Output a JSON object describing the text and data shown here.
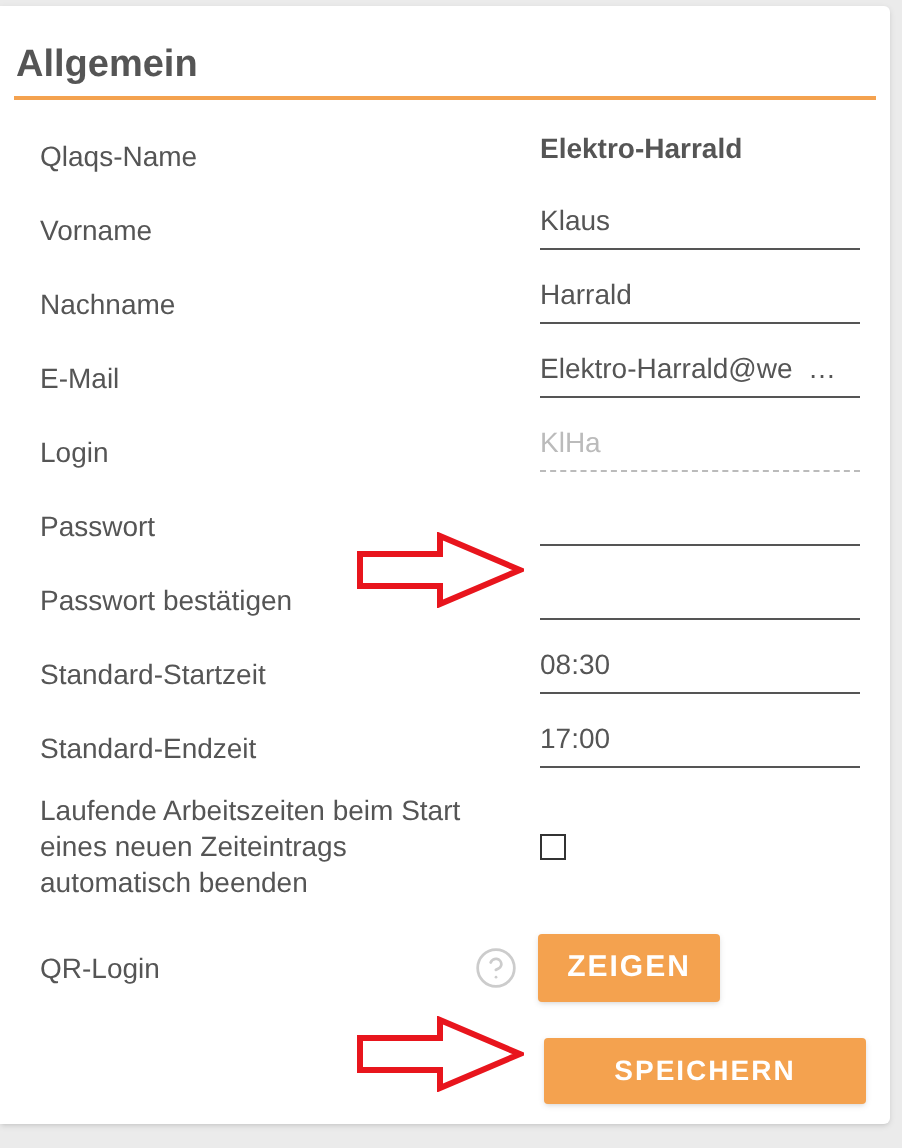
{
  "section": {
    "title": "Allgemein"
  },
  "fields": [
    {
      "label": "Qlaqs-Name",
      "kind": "static",
      "value": "Elektro-Harrald"
    },
    {
      "label": "Vorname",
      "kind": "text",
      "value": "Klaus"
    },
    {
      "label": "Nachname",
      "kind": "text",
      "value": "Harrald"
    },
    {
      "label": "E-Mail",
      "kind": "text",
      "value": "Elektro-Harrald@we  …"
    },
    {
      "label": "Login",
      "kind": "readonly",
      "value": "KlHa"
    },
    {
      "label": "Passwort",
      "kind": "password"
    },
    {
      "label": "Passwort bestätigen",
      "kind": "password"
    },
    {
      "label": "Standard-Startzeit",
      "kind": "text",
      "value": "08:30"
    },
    {
      "label": "Standard-Endzeit",
      "kind": "text",
      "value": "17:00"
    },
    {
      "label": "Laufende Arbeitszeiten beim Start eines neuen Zeiteintrags automatisch beenden",
      "kind": "checkbox",
      "checked": false
    }
  ],
  "qr_login": {
    "label": "QR-Login",
    "button": "ZEIGEN"
  },
  "save_button": "SPEICHERN"
}
